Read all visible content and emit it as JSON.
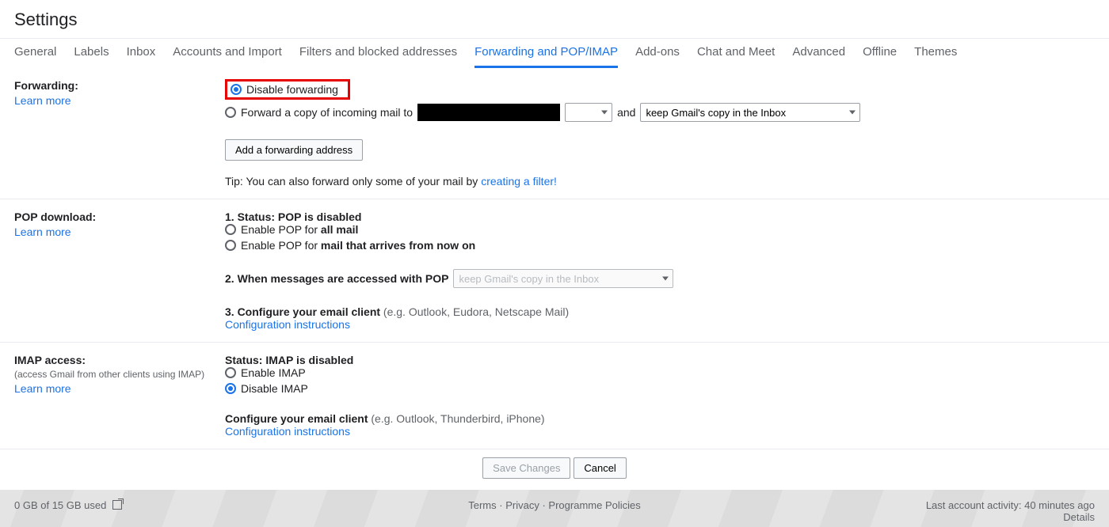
{
  "header": {
    "title": "Settings"
  },
  "tabs": [
    {
      "label": "General"
    },
    {
      "label": "Labels"
    },
    {
      "label": "Inbox"
    },
    {
      "label": "Accounts and Import"
    },
    {
      "label": "Filters and blocked addresses"
    },
    {
      "label": "Forwarding and POP/IMAP",
      "active": true
    },
    {
      "label": "Add-ons"
    },
    {
      "label": "Chat and Meet"
    },
    {
      "label": "Advanced"
    },
    {
      "label": "Offline"
    },
    {
      "label": "Themes"
    }
  ],
  "forwarding": {
    "heading": "Forwarding:",
    "learn_more": "Learn more",
    "disable_label": "Disable forwarding",
    "forward_copy_prefix": "Forward a copy of incoming mail to",
    "and_text": "and",
    "keep_copy_select": "keep Gmail's copy in the Inbox",
    "add_address_btn": "Add a forwarding address",
    "tip_prefix": "Tip: You can also forward only some of your mail by ",
    "tip_link": "creating a filter!"
  },
  "pop": {
    "heading": "POP download:",
    "learn_more": "Learn more",
    "status_prefix": "1. Status: ",
    "status_value": "POP is disabled",
    "enable_all_prefix": "Enable POP for ",
    "enable_all_bold": "all mail",
    "enable_new_prefix": "Enable POP for ",
    "enable_new_bold": "mail that arrives from now on",
    "q2_label": "2. When messages are accessed with POP",
    "q2_select": "keep Gmail's copy in the Inbox",
    "q3_bold": "3. Configure your email client",
    "q3_rest": " (e.g. Outlook, Eudora, Netscape Mail)",
    "config_link": "Configuration instructions"
  },
  "imap": {
    "heading": "IMAP access:",
    "sub": "(access Gmail from other clients using IMAP)",
    "learn_more": "Learn more",
    "status_prefix": "Status: ",
    "status_value": "IMAP is disabled",
    "enable_label": "Enable IMAP",
    "disable_label": "Disable IMAP",
    "config_bold": "Configure your email client",
    "config_rest": " (e.g. Outlook, Thunderbird, iPhone)",
    "config_link": "Configuration instructions"
  },
  "actions": {
    "save": "Save Changes",
    "cancel": "Cancel"
  },
  "footer": {
    "storage": "0 GB of 15 GB used",
    "terms": "Terms",
    "privacy": "Privacy",
    "policies": "Programme Policies",
    "activity": "Last account activity: 40 minutes ago",
    "details": "Details"
  }
}
